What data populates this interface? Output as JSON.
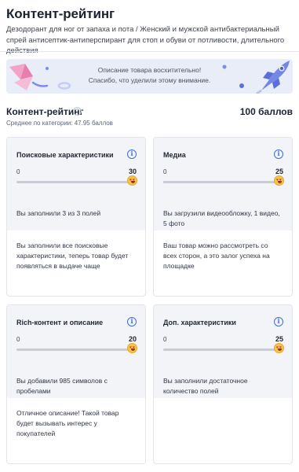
{
  "page": {
    "title": "Контент-рейтинг",
    "subtitle": "Дезодорант для ног от запаха и пота / Женский и мужской антибактериальный спрей антисептик-антиперспирант для стоп и обуви от потливости, длительного действия"
  },
  "banner": {
    "line1": "Описание товара восхитительно!",
    "line2": "Спасибо, что уделили этому внимание.",
    "colors": {
      "background": "#e8edf7",
      "pink": "#f2a3c6",
      "blue": "#6a7ee8"
    }
  },
  "rating": {
    "title": "Контент-рейтинг",
    "help_icon": "?",
    "score": "100 баллов",
    "average": "Среднее по категории: 47.95 баллов"
  },
  "cards": [
    {
      "name": "Поисковые характеристики",
      "min": "0",
      "max": "30",
      "fill_fraction": 1.0,
      "status": "Вы заполнили 3 из 3 полей",
      "description": "Вы заполнили все поисковые характеристики, теперь товар будет появляться в выдаче чаще"
    },
    {
      "name": "Медиа",
      "min": "0",
      "max": "25",
      "fill_fraction": 1.0,
      "status": "Вы загрузили видеообложку, 1 видео, 5 фото",
      "description": "Ваш товар можно рассмотреть со всех сторон, а это залог успеха на площадке"
    },
    {
      "name": "Rich-контент и описание",
      "min": "0",
      "max": "20",
      "fill_fraction": 1.0,
      "status": "Вы добавили 985 символов с пробелами",
      "description": "Отличное описание! Такой товар будет вызывать интерес у покупателей"
    },
    {
      "name": "Доп. характеристики",
      "min": "0",
      "max": "25",
      "fill_fraction": 1.0,
      "status": "Вы заполнили достаточное количество полей",
      "description": ""
    }
  ],
  "icons": {
    "info": "info-icon",
    "progress_marker": "heart-eyes-emoji-icon"
  },
  "colors": {
    "accent": "#3b6fe0",
    "card_top": "#f3f4f8"
  }
}
